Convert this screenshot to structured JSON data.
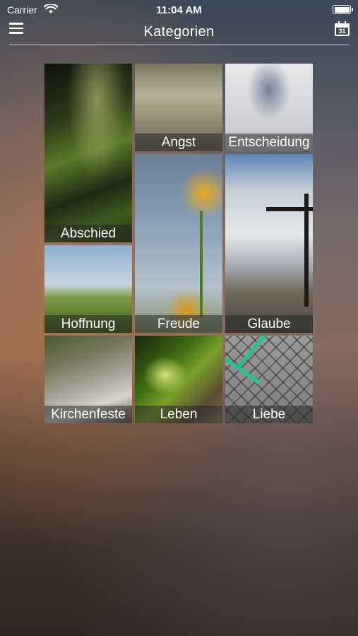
{
  "status_bar": {
    "carrier": "Carrier",
    "time": "11:04 AM"
  },
  "nav": {
    "title": "Kategorien",
    "calendar_day": "31"
  },
  "categories": [
    {
      "label": "Abschied"
    },
    {
      "label": "Angst"
    },
    {
      "label": "Entscheidung"
    },
    {
      "label": "Freude"
    },
    {
      "label": "Glaube"
    },
    {
      "label": "Hoffnung"
    },
    {
      "label": "Kirchenfeste"
    },
    {
      "label": "Leben"
    },
    {
      "label": "Liebe"
    }
  ]
}
